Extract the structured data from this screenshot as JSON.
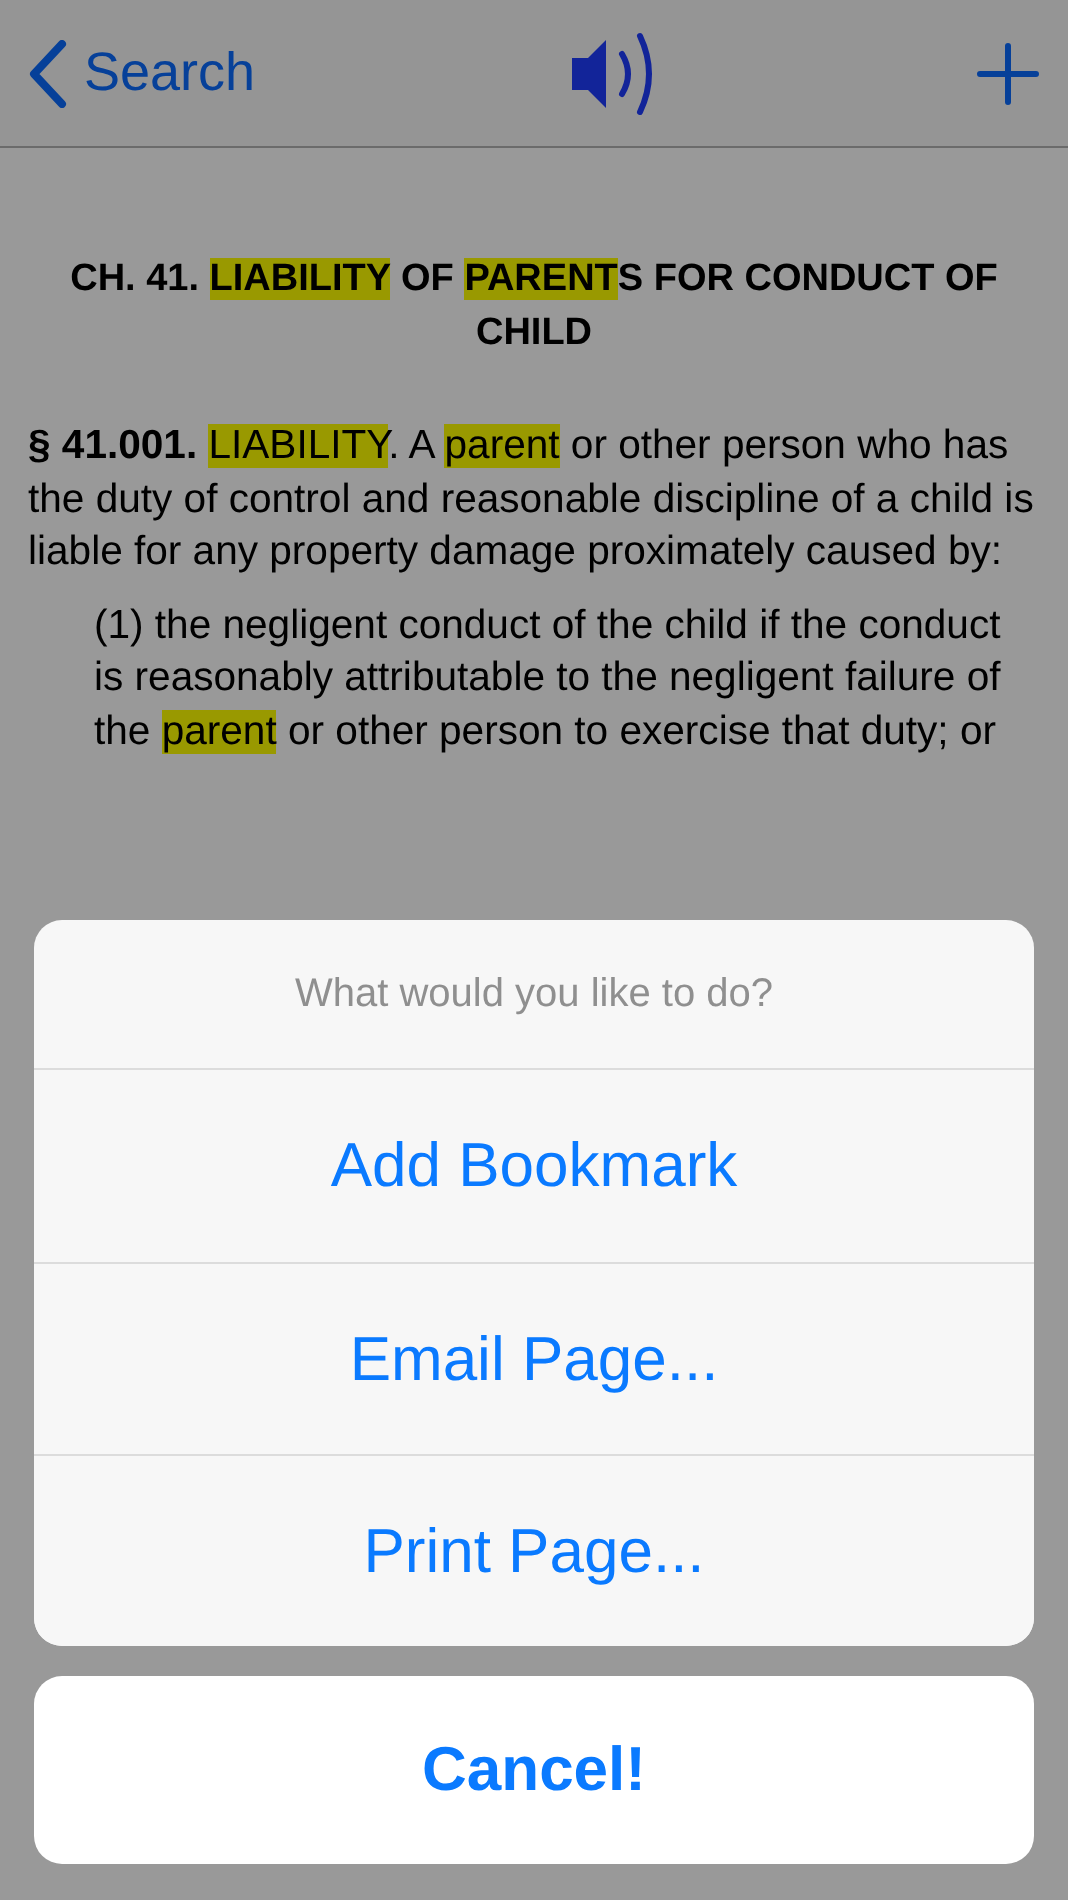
{
  "nav": {
    "back_label": "Search"
  },
  "document": {
    "heading": [
      {
        "text": "CH. 41. ",
        "highlight": false
      },
      {
        "text": "LIABILITY",
        "highlight": true
      },
      {
        "text": " OF ",
        "highlight": false
      },
      {
        "text": "PARENT",
        "highlight": true
      },
      {
        "text": "S FOR CONDUCT OF CHILD",
        "highlight": false
      }
    ],
    "paragraphs": [
      {
        "indented": false,
        "segments": [
          {
            "text": "**§ 41.001.** ",
            "highlight": false
          },
          {
            "text": "LIABILITY",
            "highlight": true
          },
          {
            "text": ". A ",
            "highlight": false
          },
          {
            "text": "parent",
            "highlight": true
          },
          {
            "text": " or other person who has the duty of control and reasonable discipline of a child is liable for any property damage proximately caused by:",
            "highlight": false
          }
        ]
      },
      {
        "indented": true,
        "segments": [
          {
            "text": "(1) the negligent conduct of the child if the conduct is reasonably attributable to the negligent failure of the ",
            "highlight": false
          },
          {
            "text": "parent",
            "highlight": true
          },
          {
            "text": " or other person to exercise that duty; or",
            "highlight": false
          }
        ]
      }
    ]
  },
  "action_sheet": {
    "title": "What would you like to do?",
    "actions": [
      "Add Bookmark",
      "Email Page...",
      "Print Page..."
    ],
    "cancel": "Cancel!"
  }
}
